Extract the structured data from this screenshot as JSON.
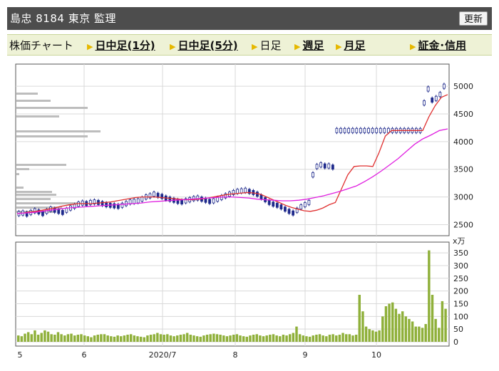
{
  "header": {
    "title": "島忠  8184  東京 監理",
    "refresh_label": "更新"
  },
  "nav": {
    "items": [
      {
        "label": "株価チャート",
        "kind": "title"
      },
      {
        "label": "日中足(1分)",
        "kind": "link"
      },
      {
        "label": "日中足(5分)",
        "kind": "link"
      },
      {
        "label": "日足",
        "kind": "current"
      },
      {
        "label": "週足",
        "kind": "link"
      },
      {
        "label": "月足",
        "kind": "link"
      },
      {
        "label": "証金･信用",
        "kind": "link"
      }
    ]
  },
  "colors": {
    "candle": "#1f2a8c",
    "ma_short": "#e03030",
    "ma_long": "#e020e0",
    "volume": "#8fb03a",
    "volume_profile": "#bdbdbd"
  },
  "chart_data": [
    {
      "type": "candlestick",
      "title": "",
      "y_ticks": [
        "5000",
        "4500",
        "4000",
        "3500",
        "3000",
        "2500"
      ],
      "ylim": [
        2300,
        5400
      ],
      "x_labels": [
        "5",
        "6",
        "2020/7",
        "8",
        "9",
        "10"
      ],
      "grid": true,
      "series": [
        {
          "type": "candles",
          "values": [
            2700,
            2710,
            2690,
            2720,
            2750,
            2730,
            2700,
            2740,
            2780,
            2760,
            2740,
            2720,
            2760,
            2800,
            2830,
            2870,
            2890,
            2880,
            2900,
            2910,
            2900,
            2880,
            2860,
            2850,
            2840,
            2830,
            2850,
            2880,
            2910,
            2920,
            2930,
            2960,
            3000,
            3020,
            3050,
            3030,
            3010,
            2980,
            2960,
            2940,
            2920,
            2910,
            2930,
            2950,
            2970,
            2980,
            2960,
            2940,
            2920,
            2930,
            2960,
            2990,
            3020,
            3050,
            3080,
            3100,
            3110,
            3120,
            3100,
            3080,
            3050,
            3000,
            2950,
            2900,
            2870,
            2850,
            2820,
            2780,
            2740,
            2710,
            2760,
            2820,
            2860,
            2900,
            3400,
            3550,
            3580,
            3560,
            3560,
            3540,
            4200,
            4200,
            4200,
            4200,
            4200,
            4200,
            4200,
            4200,
            4200,
            4200,
            4200,
            4200,
            4200,
            4200,
            4200,
            4200,
            4200,
            4200,
            4200,
            4200,
            4200,
            4200,
            4700,
            4950,
            4750,
            4780,
            4850,
            5000
          ]
        },
        {
          "type": "line",
          "values": [
            2700,
            2710,
            2730,
            2740,
            2760,
            2780,
            2800,
            2830,
            2850,
            2870,
            2880,
            2880,
            2880,
            2890,
            2900,
            2910,
            2930,
            2950,
            2970,
            2990,
            3000,
            3000,
            3000,
            2990,
            2980,
            2970,
            2960,
            2950,
            2950,
            2960,
            2970,
            2990,
            3010,
            3030,
            3050,
            3060,
            3070,
            3080,
            3070,
            3050,
            3000,
            2950,
            2900,
            2850,
            2810,
            2780,
            2750,
            2740,
            2760,
            2800,
            2860,
            2900,
            3150,
            3400,
            3550,
            3560,
            3560,
            3550,
            3800,
            4100,
            4200,
            4200,
            4200,
            4200,
            4200,
            4200,
            4450,
            4650,
            4800,
            4850
          ]
        },
        {
          "type": "line",
          "values": [
            2700,
            2710,
            2720,
            2740,
            2760,
            2780,
            2800,
            2810,
            2820,
            2830,
            2840,
            2850,
            2860,
            2870,
            2880,
            2890,
            2910,
            2920,
            2930,
            2940,
            2950,
            2960,
            2970,
            2980,
            2990,
            3000,
            3000,
            2990,
            2980,
            2960,
            2950,
            2940,
            2930,
            2930,
            2940,
            2960,
            2990,
            3020,
            3060,
            3100,
            3150,
            3200,
            3280,
            3370,
            3470,
            3580,
            3690,
            3820,
            3950,
            4050,
            4120,
            4200,
            4230
          ]
        }
      ]
    },
    {
      "type": "bar",
      "title": "",
      "ylabel": "x万",
      "y_ticks": [
        "350",
        "300",
        "250",
        "200",
        "150",
        "100",
        "50",
        "0"
      ],
      "ylim": [
        0,
        370
      ],
      "series": [
        {
          "name": "",
          "values": [
            25,
            22,
            32,
            38,
            30,
            45,
            28,
            35,
            45,
            40,
            30,
            28,
            38,
            30,
            25,
            30,
            32,
            25,
            28,
            30,
            25,
            22,
            18,
            25,
            28,
            30,
            30,
            25,
            22,
            20,
            25,
            22,
            25,
            28,
            30,
            25,
            22,
            20,
            18,
            25,
            28,
            30,
            35,
            30,
            28,
            30,
            25,
            22,
            25,
            28,
            30,
            35,
            28,
            25,
            22,
            20,
            25,
            28,
            30,
            32,
            30,
            28,
            25,
            22,
            25,
            28,
            30,
            25,
            22,
            20,
            25,
            28,
            30,
            25,
            22,
            25,
            28,
            30,
            25,
            22,
            28,
            25,
            30,
            35,
            60,
            30,
            25,
            22,
            20,
            25,
            28,
            30,
            25,
            22,
            28,
            30,
            25,
            28,
            35,
            30,
            30,
            25,
            28,
            185,
            120,
            60,
            50,
            45,
            40,
            45,
            100,
            140,
            150,
            155,
            130,
            110,
            120,
            100,
            90,
            80,
            60,
            60,
            55,
            70,
            360,
            185,
            90,
            55,
            160,
            130
          ]
        }
      ]
    }
  ]
}
